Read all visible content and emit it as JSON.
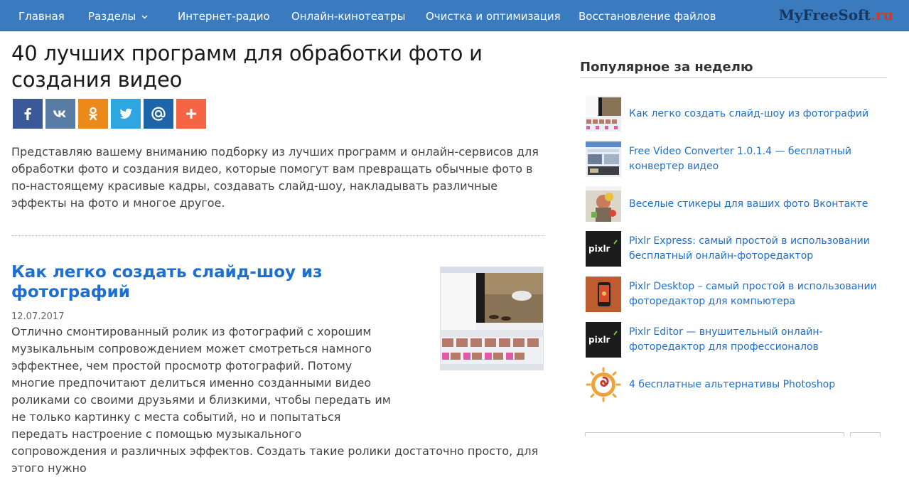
{
  "nav": {
    "items": [
      {
        "label": "Главная"
      },
      {
        "label": "Разделы"
      },
      {
        "label": "Интернет-радио"
      },
      {
        "label": "Онлайн-кинотеатры"
      },
      {
        "label": "Очистка и оптимизация"
      },
      {
        "label": "Восстановление файлов"
      }
    ],
    "dropdown_icon": "chevron-down-icon",
    "logo_main": "MyFreeSoft",
    "logo_tld": ".ru"
  },
  "article": {
    "title": "40 лучших программ для обработки фото и создания видео",
    "intro": "Представляю вашему вниманию подборку из лучших программ и онлайн-сервисов для обработки фото и создания видео, которые помогут вам превращать обычные фото в по-настоящему красивые кадры, создавать слайд-шоу, накладывать различные эффекты на фото и многое другое."
  },
  "share": {
    "buttons": [
      {
        "icon": "facebook-icon",
        "color": "#3b5998"
      },
      {
        "icon": "vk-icon",
        "color": "#587ca3"
      },
      {
        "icon": "odnoklassniki-icon",
        "color": "#eb8a1a"
      },
      {
        "icon": "twitter-icon",
        "color": "#2ea6e0"
      },
      {
        "icon": "mail-ru-icon",
        "color": "#1e64a8"
      },
      {
        "icon": "plus-icon",
        "color": "#f56445"
      }
    ]
  },
  "post": {
    "title": "Как легко создать слайд-шоу из фотографий",
    "date": "12.07.2017",
    "excerpt": "Отлично смонтированный ролик из фотографий с хорошим музыкальным сопровождением может смотреться намного эффектнее, чем простой просмотр фотографий. Потому многие предпочитают делиться именно созданными видео роликами со своими друзьями и близкими, чтобы передать им не только картинку с места событий, но и попытаться передать настроение с помощью музыкального сопровождения и различных эффектов. Создать такие ролики достаточно просто, для этого нужно"
  },
  "sidebar": {
    "heading": "Популярное за неделю",
    "items": [
      {
        "label": "Как легко создать слайд-шоу из фотографий"
      },
      {
        "label": "Free Video Converter 1.0.1.4 — бесплатный конвертер видео"
      },
      {
        "label": "Веселые стикеры для ваших фото Вконтакте"
      },
      {
        "label": "Pixlr Express: самый простой в использовании бесплатный онлайн-фоторедактор"
      },
      {
        "label": "Pixlr Desktop – самый простой в использовании фоторедактор для компьютера"
      },
      {
        "label": "Pixlr Editor — внушительный онлайн-фоторедактор для профессионалов"
      },
      {
        "label": "4 бесплатные альтернативы Photoshop"
      }
    ],
    "pixlr_logo_text": "pixlr"
  },
  "colors": {
    "nav_bg": "#3a7bbf",
    "link": "#1d6fd0",
    "logo_main": "#17375f",
    "logo_tld": "#d23a1f"
  }
}
